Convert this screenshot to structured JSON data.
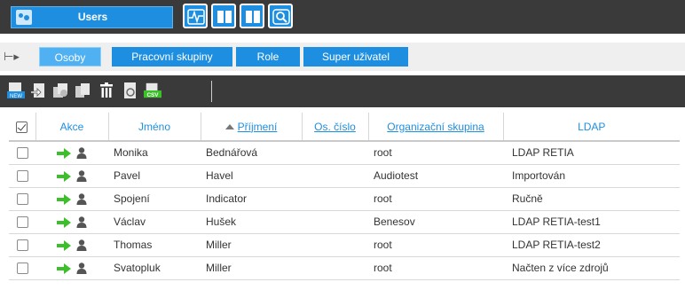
{
  "topbar": {
    "section_label": "Users",
    "section_icon": "users-icon",
    "module_buttons": [
      "pulse-icon",
      "book-icon",
      "book-icon",
      "people-search-icon"
    ]
  },
  "tabs": [
    {
      "label": "Osoby",
      "active": true
    },
    {
      "label": "Pracovní skupiny",
      "active": false
    },
    {
      "label": "Role",
      "active": false
    },
    {
      "label": "Super uživatel",
      "active": false
    }
  ],
  "toolbar": {
    "buttons": [
      "new-icon",
      "import-icon",
      "copy-icon",
      "duplicate-icon",
      "delete-icon",
      "properties-icon",
      "csv-export-icon"
    ],
    "new_text": "NEW",
    "csv_text": "CSV"
  },
  "table": {
    "headers": {
      "akce": "Akce",
      "jmeno": "Jméno",
      "prijmeni": "Příjmení",
      "os_cislo": "Os. číslo",
      "org_skupina": "Organizační skupina",
      "ldap": "LDAP"
    },
    "rows": [
      {
        "jmeno": "Monika",
        "prijmeni": "Bednářová",
        "os_cislo": "",
        "org_skupina": "root",
        "ldap": "LDAP RETIA"
      },
      {
        "jmeno": "Pavel",
        "prijmeni": "Havel",
        "os_cislo": "",
        "org_skupina": "Audiotest",
        "ldap": "Importován"
      },
      {
        "jmeno": "Spojení",
        "prijmeni": "Indicator",
        "os_cislo": "",
        "org_skupina": "root",
        "ldap": "Ručně"
      },
      {
        "jmeno": "Václav",
        "prijmeni": "Hušek",
        "os_cislo": "",
        "org_skupina": "Benesov",
        "ldap": "LDAP RETIA-test1"
      },
      {
        "jmeno": "Thomas",
        "prijmeni": "Miller",
        "os_cislo": "",
        "org_skupina": "root",
        "ldap": "LDAP RETIA-test2"
      },
      {
        "jmeno": "Svatopluk",
        "prijmeni": "Miller",
        "os_cislo": "",
        "org_skupina": "root",
        "ldap": "Načten z více zdrojů"
      }
    ]
  },
  "colors": {
    "accent": "#1e8fe0",
    "dark_bar": "#3a3a3a",
    "arrow_green": "#3cbf2a"
  }
}
